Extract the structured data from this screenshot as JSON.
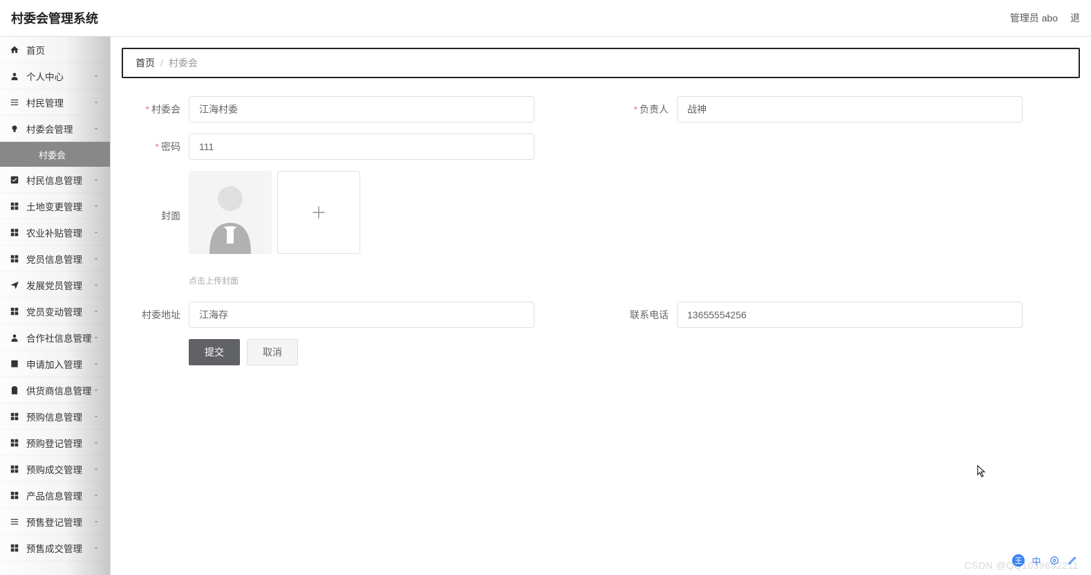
{
  "header": {
    "title": "村委会管理系统",
    "user_prefix": "管理员",
    "username": "abo",
    "logout": "退"
  },
  "sidebar": {
    "items": [
      {
        "icon": "home",
        "label": "首页",
        "expandable": false
      },
      {
        "icon": "user",
        "label": "个人中心",
        "expandable": true
      },
      {
        "icon": "list",
        "label": "村民管理",
        "expandable": true
      },
      {
        "icon": "bulb",
        "label": "村委会管理",
        "expandable": true,
        "active": true,
        "sub": "村委会"
      },
      {
        "icon": "check",
        "label": "村民信息管理",
        "expandable": true
      },
      {
        "icon": "grid",
        "label": "土地变更管理",
        "expandable": true
      },
      {
        "icon": "grid",
        "label": "农业补贴管理",
        "expandable": true
      },
      {
        "icon": "grid",
        "label": "党员信息管理",
        "expandable": true
      },
      {
        "icon": "plane",
        "label": "发展党员管理",
        "expandable": true
      },
      {
        "icon": "grid",
        "label": "党员变动管理",
        "expandable": true
      },
      {
        "icon": "user",
        "label": "合作社信息管理",
        "expandable": true
      },
      {
        "icon": "box",
        "label": "申请加入管理",
        "expandable": true
      },
      {
        "icon": "clipboard",
        "label": "供货商信息管理",
        "expandable": true
      },
      {
        "icon": "grid",
        "label": "预购信息管理",
        "expandable": true
      },
      {
        "icon": "grid",
        "label": "预购登记管理",
        "expandable": true
      },
      {
        "icon": "grid",
        "label": "预购成交管理",
        "expandable": true
      },
      {
        "icon": "grid",
        "label": "产品信息管理",
        "expandable": true
      },
      {
        "icon": "list",
        "label": "预售登记管理",
        "expandable": true
      },
      {
        "icon": "grid",
        "label": "预售成交管理",
        "expandable": true
      }
    ]
  },
  "breadcrumb": {
    "home": "首页",
    "sep": "/",
    "current": "村委会"
  },
  "form": {
    "committee_label": "村委会",
    "committee_value": "江海村委",
    "owner_label": "负责人",
    "owner_value": "战神",
    "password_label": "密码",
    "password_value": "111",
    "cover_label": "封面",
    "upload_hint": "点击上传封面",
    "address_label": "村委地址",
    "address_value": "江海存",
    "phone_label": "联系电话",
    "phone_value": "13655554256",
    "submit": "提交",
    "cancel": "取消"
  },
  "watermark": "CSDN @QQ1039692211",
  "ime": {
    "lang": "中"
  }
}
